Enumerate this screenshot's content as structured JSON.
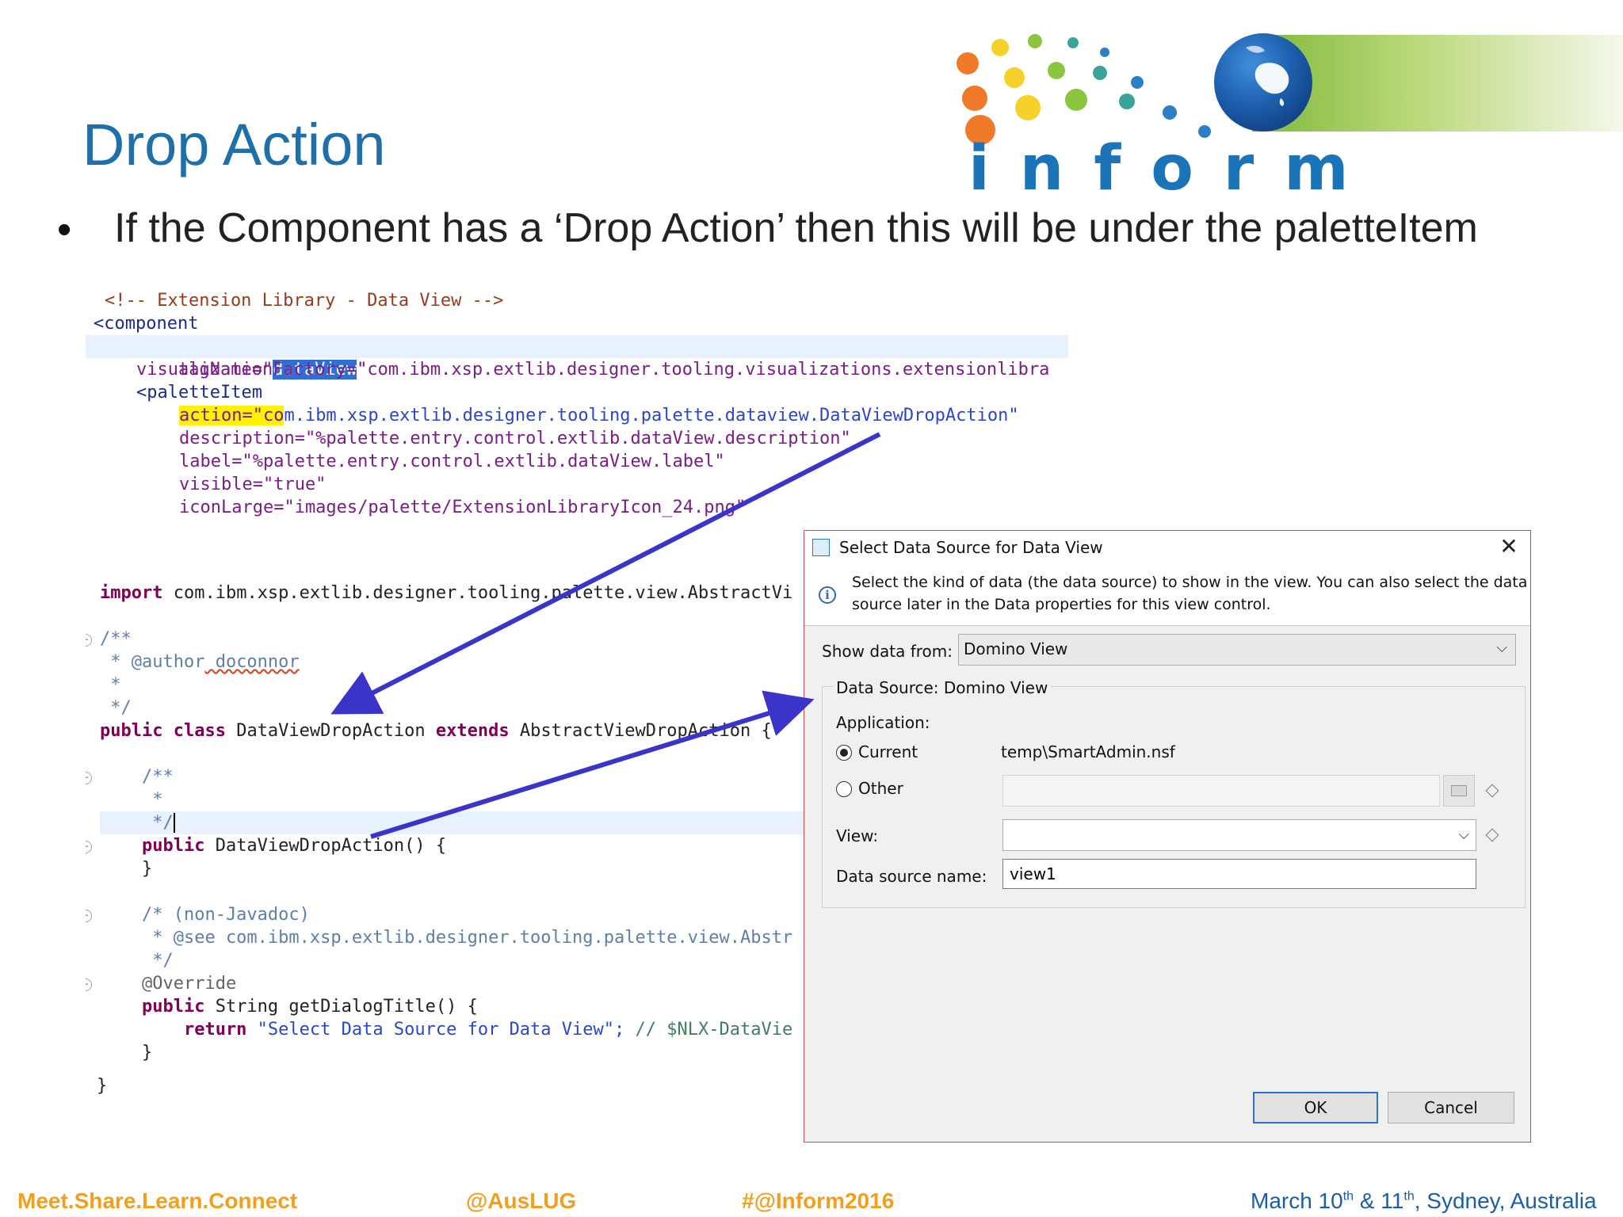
{
  "slide": {
    "title": "Drop Action",
    "bullet": "If the Component has a ‘Drop Action’ then this will be under the paletteItem"
  },
  "logo": {
    "word": "inform"
  },
  "xml_code": {
    "comment": "<!-- Extension Library - Data View -->",
    "component_open": "<component",
    "tagname_attr": "tagName=\"",
    "tagname_value": "dataView",
    "tagname_close": "\"",
    "vizfactory": "visualizationFactory=\"com.ibm.xsp.extlib.designer.tooling.visualizations.extensionlibra",
    "paletteitem_open": "<paletteItem",
    "action_attr": "action=\"co",
    "action_value": "m.ibm.xsp.extlib.designer.tooling.palette.dataview.DataViewDropAction\"",
    "description": "description=\"%palette.entry.control.extlib.dataView.description\"",
    "label": "label=\"%palette.entry.control.extlib.dataView.label\"",
    "visible": "visible=\"true\"",
    "iconlarge": "iconLarge=\"images/palette/ExtensionLibraryIcon_24.png\""
  },
  "java_code": {
    "import_kw": "import",
    "import_rest": " com.ibm.xsp.extlib.designer.tooling.palette.view.AbstractVi",
    "jd_open": "/**",
    "jd_author_tag": " * @author",
    "jd_author_name": " doconnor",
    "jd_star": " *",
    "jd_close": " */",
    "class_kw1": "public class",
    "class_name": " DataViewDropAction ",
    "class_kw2": "extends",
    "class_super": " AbstractViewDropAction {",
    "ctor_jd_open": "    /**",
    "ctor_jd_star": "     *",
    "ctor_jd_close": "     */",
    "ctor_kw": "    public",
    "ctor_sig": " DataViewDropAction() {",
    "ctor_close": "    }",
    "nonjd": "    /* (non-Javadoc)",
    "see": "     * @see com.ibm.xsp.extlib.designer.tooling.palette.view.Abstr",
    "nonjd_close": "     */",
    "override": "    @Override",
    "method_kw": "    public",
    "method_sig": " String getDialogTitle() {",
    "return_kw": "        return",
    "return_str": " \"Select Data Source for Data View\";",
    "return_cmt": " // $NLX-DataVie",
    "method_close": "    }",
    "class_close": "}"
  },
  "dialog": {
    "title": "Select Data Source for Data View",
    "close_glyph": "✕",
    "info_glyph": "i",
    "message_line1": "Select the kind of data (the data source) to show in the view. You can also select the data",
    "message_line2": "source later in the Data properties for this view control.",
    "show_from_label": "Show data from:",
    "show_from_value": "Domino View",
    "chevron": "⌵",
    "group_legend": "Data Source: Domino View",
    "application_label": "Application:",
    "current_label": "Current",
    "current_value": "temp\\SmartAdmin.nsf",
    "current_selected": true,
    "other_label": "Other",
    "view_label": "View:",
    "view_value": "",
    "dsn_label": "Data source name:",
    "dsn_value": "view1",
    "ok_label": "OK",
    "cancel_label": "Cancel"
  },
  "footer": {
    "tagline": "Meet.Share.Learn.Connect",
    "handle": "@AusLUG",
    "hashtag": "#@Inform2016",
    "date_a": "March 10",
    "date_sup1": "th",
    "date_b": " & 11",
    "date_sup2": "th",
    "date_c": ", Sydney, Australia"
  },
  "colors": {
    "title_blue": "#1f6fa8",
    "footer_orange": "#f0a020",
    "arrow_blue": "#3a35c8",
    "selection_blue": "#2f6fd6"
  }
}
